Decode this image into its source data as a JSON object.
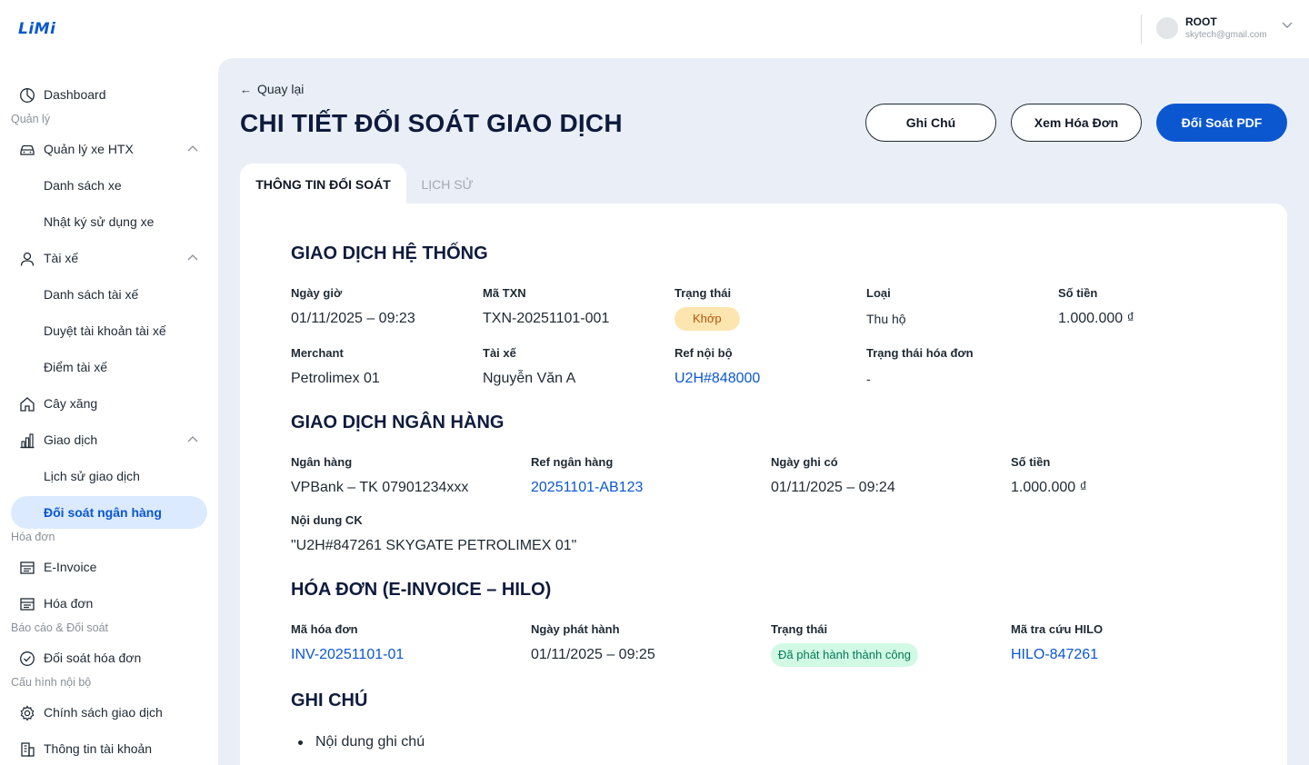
{
  "brand": {
    "logo": "LiMi"
  },
  "user": {
    "name": "ROOT",
    "email": "skytech@gmail.com"
  },
  "sidebar": {
    "items": [
      {
        "label": "Dashboard",
        "icon": "dashboard-icon"
      },
      {
        "section": "Quản lý"
      },
      {
        "label": "Quản lý xe HTX",
        "icon": "car-icon",
        "expanded": true
      },
      {
        "label": "Danh sách xe"
      },
      {
        "label": "Nhật ký sử dụng xe"
      },
      {
        "label": "Tài xế",
        "icon": "user-icon",
        "expanded": true
      },
      {
        "label": "Danh sách tài xế"
      },
      {
        "label": "Duyệt tài khoản tài xế"
      },
      {
        "label": "Điểm tài xế"
      },
      {
        "label": "Cây xăng",
        "icon": "home-icon"
      },
      {
        "label": "Giao dịch",
        "icon": "bar-chart-icon",
        "expanded": true
      },
      {
        "label": "Lịch sử giao dịch"
      },
      {
        "label": "Đối soát ngân hàng",
        "active": true
      },
      {
        "section": "Hóa đơn"
      },
      {
        "label": "E-Invoice",
        "icon": "invoice-icon"
      },
      {
        "label": "Hóa đơn",
        "icon": "invoice-icon"
      },
      {
        "section": "Báo cáo & Đối soát"
      },
      {
        "label": "Đối soát hóa đơn",
        "icon": "check-circle-icon"
      },
      {
        "section": "Cấu hình nội bộ"
      },
      {
        "label": "Chính sách giao dịch",
        "icon": "gear-icon"
      },
      {
        "label": "Thông tin tài khoản",
        "icon": "building-icon"
      }
    ]
  },
  "header": {
    "back": "Quay lại",
    "title": "CHI TIẾT ĐỐI SOÁT GIAO DỊCH",
    "buttons": {
      "note": "Ghi Chú",
      "view_invoice": "Xem Hóa Đơn",
      "pdf": "Đối Soát PDF"
    }
  },
  "tabs": {
    "info": "THÔNG TIN ĐỐI SOÁT",
    "history": "LỊCH SỬ"
  },
  "system": {
    "title": "GIAO DỊCH HỆ THỐNG",
    "datetime": {
      "label": "Ngày giờ",
      "value": "01/11/2025 – 09:23"
    },
    "txn": {
      "label": "Mã TXN",
      "value": "TXN-20251101-001"
    },
    "status": {
      "label": "Trạng thái",
      "value": "Khớp"
    },
    "type": {
      "label": "Loại",
      "value": "Thu hộ"
    },
    "amount": {
      "label": "Số tiền",
      "value": "1.000.000 ₫"
    },
    "merchant": {
      "label": "Merchant",
      "value": "Petrolimex 01"
    },
    "driver": {
      "label": "Tài xế",
      "value": "Nguyễn Văn A"
    },
    "ref": {
      "label": "Ref nội bộ",
      "value": "U2H#848000"
    },
    "invoice_status": {
      "label": "Trạng thái hóa đơn",
      "value": "-"
    }
  },
  "bank": {
    "title": "GIAO DỊCH NGÂN HÀNG",
    "bank": {
      "label": "Ngân hàng",
      "value": "VPBank – TK 07901234xxx"
    },
    "ref": {
      "label": "Ref ngân hàng",
      "value": "20251101-AB123"
    },
    "credit_date": {
      "label": "Ngày ghi có",
      "value": "01/11/2025 – 09:24"
    },
    "amount": {
      "label": "Số tiền",
      "value": "1.000.000 ₫"
    },
    "content": {
      "label": "Nội dung CK",
      "value": "\"U2H#847261 SKYGATE PETROLIMEX 01\""
    }
  },
  "invoice": {
    "title": "HÓA ĐƠN (E-INVOICE – HILO)",
    "code": {
      "label": "Mã hóa đơn",
      "value": "INV-20251101-01"
    },
    "issue_date": {
      "label": "Ngày phát hành",
      "value": "01/11/2025 – 09:25"
    },
    "status": {
      "label": "Trạng thái",
      "value": "Đã phát hành thành công"
    },
    "hilo": {
      "label": "Mã tra cứu HILO",
      "value": "HILO-847261"
    }
  },
  "notes": {
    "title": "GHI CHÚ",
    "items": [
      "Nội dung ghi chú"
    ]
  },
  "colors": {
    "primary": "#0b57d0",
    "background": "#eaeff7",
    "active_nav": "#dbeafe",
    "title": "#0f1b3d"
  }
}
